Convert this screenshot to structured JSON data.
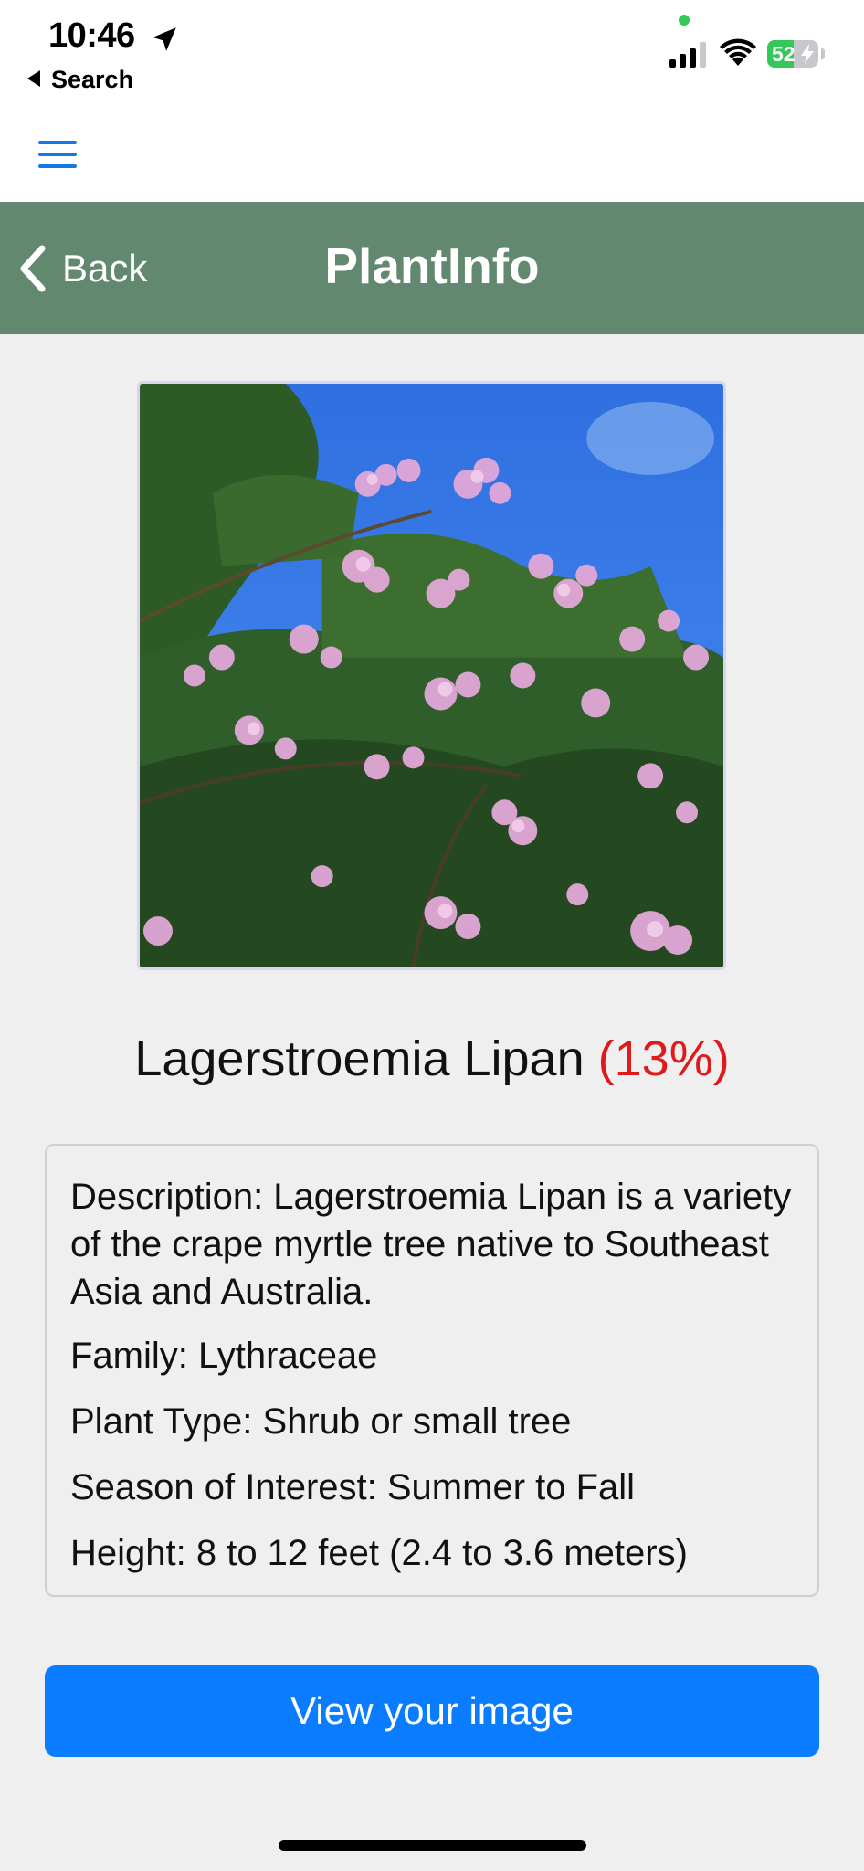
{
  "status_bar": {
    "time": "10:46",
    "back_app_label": "Search",
    "battery_percent": "52",
    "battery_level": 0.52,
    "icons": [
      "location-arrow-icon",
      "signal-icon",
      "wifi-icon",
      "battery-icon"
    ]
  },
  "header": {
    "back_label": "Back",
    "title": "PlantInfo",
    "background_color": "#628870"
  },
  "top_bar": {
    "menu_icon": "hamburger-menu-icon",
    "accent_color": "#1479e6"
  },
  "plant": {
    "name": "Lagerstroemia Lipan",
    "confidence": "(13%)",
    "confidence_color": "#e01a1a",
    "image_subject": "pink crape myrtle blossoms against blue sky"
  },
  "info": {
    "description": "Description: Lagerstroemia Lipan is a variety of the crape myrtle tree native to Southeast Asia and Australia.",
    "family": "Family: Lythraceae",
    "plant_type": "Plant Type: Shrub or small tree",
    "season": "Season of Interest: Summer to Fall",
    "height": "Height: 8 to 12 feet (2.4 to 3.6 meters)"
  },
  "actions": {
    "view_image_label": "View your image",
    "button_color": "#0a7cff"
  }
}
